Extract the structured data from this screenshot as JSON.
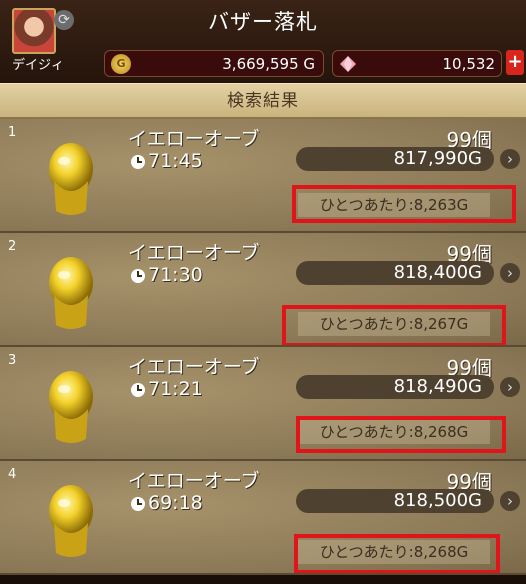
{
  "header": {
    "title": "バザー落札",
    "player_name": "デイジィ",
    "gold": "3,669,595 G",
    "gems": "10,532",
    "coin_symbol": "G",
    "plus": "+",
    "refresh_symbol": "⟳"
  },
  "results_title": "検索結果",
  "colors": {
    "highlight": "#e0151a",
    "item_gold": "#f3d12a"
  },
  "listings": [
    {
      "index": "1",
      "name": "イエローオーブ",
      "quantity": "99個",
      "time_left": "71:45",
      "price": "817,990G",
      "per_unit": "ひとつあたり:8,263G"
    },
    {
      "index": "2",
      "name": "イエローオーブ",
      "quantity": "99個",
      "time_left": "71:30",
      "price": "818,400G",
      "per_unit": "ひとつあたり:8,267G"
    },
    {
      "index": "3",
      "name": "イエローオーブ",
      "quantity": "99個",
      "time_left": "71:21",
      "price": "818,490G",
      "per_unit": "ひとつあたり:8,268G"
    },
    {
      "index": "4",
      "name": "イエローオーブ",
      "quantity": "99個",
      "time_left": "69:18",
      "price": "818,500G",
      "per_unit": "ひとつあたり:8,268G"
    }
  ],
  "arrow_glyph": "›"
}
